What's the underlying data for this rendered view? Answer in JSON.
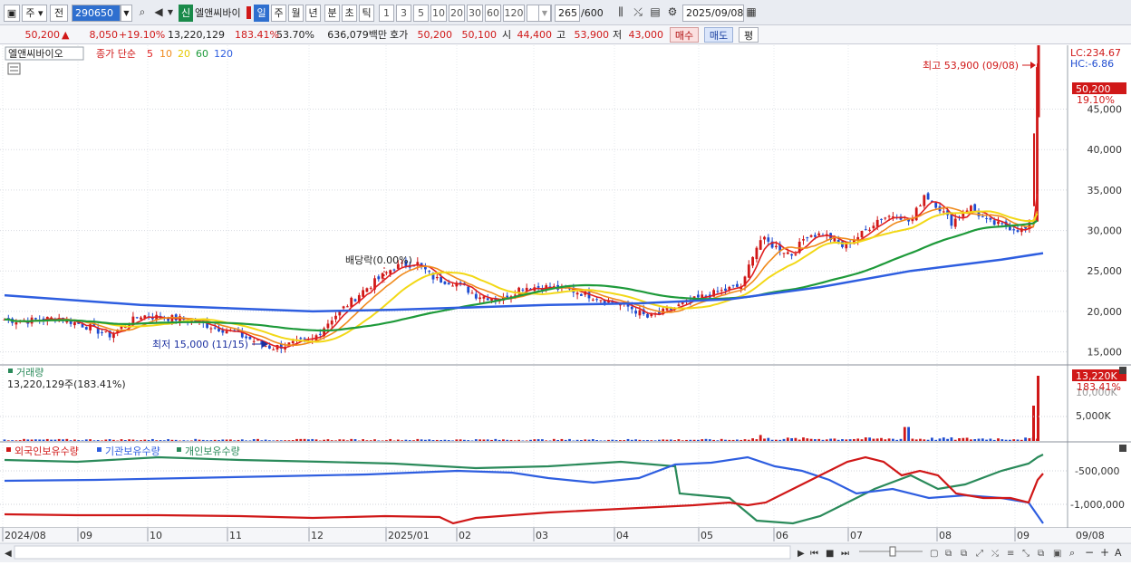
{
  "toolbar": {
    "market": "주",
    "prev": "전",
    "code": "290650",
    "type_badge": "신",
    "stock_name": "엘앤씨바이",
    "periods": [
      "일",
      "주",
      "월",
      "년",
      "분",
      "초",
      "틱"
    ],
    "intervals": [
      "1",
      "3",
      "5",
      "10",
      "20",
      "30",
      "60",
      "120"
    ],
    "count": "265",
    "count_max": "/600",
    "date": "2025/09/08"
  },
  "quote": {
    "price": "50,200",
    "change": "8,050",
    "change_pct": "+19.10%",
    "volume": "13,220,129",
    "volume_pct": "183.41%",
    "ratio": "53.70%",
    "amount": "636,079백만",
    "ask_label": "호가",
    "ask": "50,200",
    "bid": "50,100",
    "open_label": "시",
    "open": "44,400",
    "high_label": "고",
    "high": "53,900",
    "low_label": "저",
    "low": "43,000",
    "buy": "매수",
    "sell": "매도",
    "eval": "평"
  },
  "price_panel": {
    "name_label": "엘앤씨바이오",
    "legend_close": "종가 단순",
    "legend_ma": [
      "5",
      "10",
      "20",
      "60",
      "120"
    ],
    "lc": "LC:234.67",
    "hc": "HC:-6.86",
    "current_price": "50,200",
    "current_pct": "19.10%",
    "high_annotation": "최고 53,900 (09/08)",
    "low_annotation": "최저 15,000 (11/15)",
    "dividend_annotation": "배당락(0.00%)",
    "y_ticks": [
      "45,000",
      "40,000",
      "35,000",
      "30,000",
      "25,000",
      "20,000",
      "15,000"
    ]
  },
  "volume_panel": {
    "title": "거래량",
    "value": "13,220,129주(183.41%)",
    "badge": "13,220K",
    "badge_pct": "183.41%",
    "badge_ghost": "10,000K",
    "tick": "5,000K"
  },
  "holdings_panel": {
    "legend": [
      "외국인보유수량",
      "기관보유수량",
      "개인보유수량"
    ],
    "ticks": [
      "-500,000",
      "-1,000,000"
    ]
  },
  "x_axis": [
    "2024/08",
    "09",
    "10",
    "11",
    "12",
    "2025/01",
    "02",
    "03",
    "04",
    "05",
    "06",
    "07",
    "08",
    "09"
  ],
  "x_end": "09/08",
  "colors": {
    "up": "#d01818",
    "down": "#1f4cd0",
    "ma5": "#e02020",
    "ma10": "#f08a1c",
    "ma20": "#f2d816",
    "ma60": "#1e9a3a",
    "ma120": "#2e5ee0",
    "foreign": "#d01818",
    "institution": "#2e5ee0",
    "individual": "#2a8a5a"
  },
  "chart_data": [
    {
      "type": "line",
      "title": "엘앤씨바이오",
      "x": [
        "2024/08",
        "09",
        "10",
        "11",
        "12",
        "2025/01",
        "02",
        "03",
        "04",
        "05",
        "06",
        "07",
        "08",
        "09/08"
      ],
      "series": [
        {
          "name": "종가",
          "values": [
            18500,
            17500,
            19500,
            16000,
            16500,
            25000,
            21500,
            23000,
            19500,
            22000,
            28000,
            30000,
            32000,
            50200
          ]
        },
        {
          "name": "120",
          "values": [
            22000,
            21000,
            20500,
            20000,
            19500,
            20000,
            20500,
            21000,
            21000,
            21500,
            23000,
            25000,
            26000,
            27000
          ]
        }
      ],
      "ylim": [
        13500,
        52000
      ]
    },
    {
      "type": "bar",
      "title": "거래량",
      "x": [
        "2024/08",
        "09",
        "10",
        "11",
        "12",
        "2025/01",
        "02",
        "03",
        "04",
        "05",
        "06",
        "07",
        "08",
        "09/08"
      ],
      "values": [
        300,
        250,
        300,
        350,
        400,
        800,
        500,
        400,
        350,
        500,
        700,
        600,
        1500,
        13220
      ],
      "ylabel": "K"
    }
  ]
}
